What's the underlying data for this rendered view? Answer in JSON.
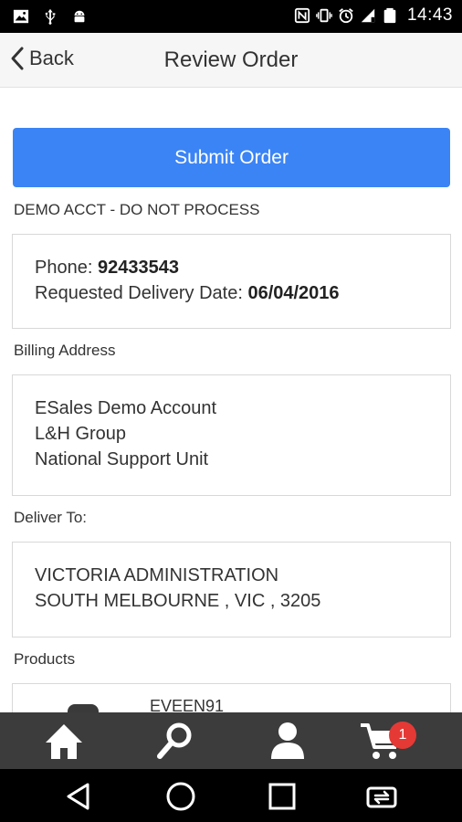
{
  "status_bar": {
    "left_icons": [
      "image-icon",
      "usb-icon",
      "android-icon"
    ],
    "right_icons": [
      "nfc-icon",
      "vibrate-icon",
      "alarm-icon",
      "signal-icon",
      "battery-icon"
    ],
    "time": "14:43"
  },
  "nav": {
    "back_label": "Back",
    "title": "Review Order"
  },
  "submit_label": "Submit Order",
  "account_note": "DEMO ACCT - DO NOT PROCESS",
  "contact": {
    "phone_label": "Phone: ",
    "phone_value": "92433543",
    "delivery_label": "Requested Delivery Date: ",
    "delivery_value": "06/04/2016"
  },
  "billing": {
    "heading": "Billing Address",
    "lines": [
      "ESales Demo Account",
      "L&H Group",
      "National Support Unit"
    ]
  },
  "deliver": {
    "heading": "Deliver To:",
    "lines": [
      "VICTORIA ADMINISTRATION",
      "SOUTH MELBOURNE , VIC , 3205"
    ]
  },
  "products": {
    "heading": "Products",
    "first_code": "EVEEN91"
  },
  "tabbar": {
    "items": [
      "home-icon",
      "search-icon",
      "profile-icon",
      "cart-icon"
    ],
    "cart_badge": "1"
  },
  "system_nav": [
    "back-triangle-icon",
    "home-circle-icon",
    "recents-square-icon",
    "switch-app-icon"
  ]
}
